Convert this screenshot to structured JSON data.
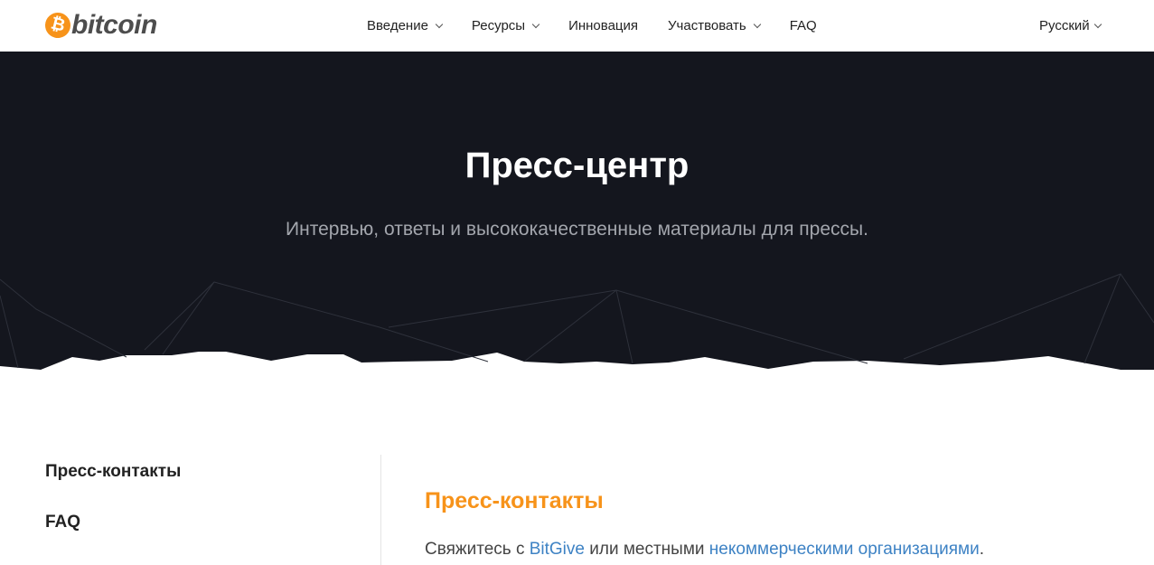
{
  "header": {
    "logo": {
      "coin_symbol": "₿",
      "text": "bitcoin",
      "color": "#f7931a"
    },
    "nav": [
      {
        "label": "Введение",
        "dropdown": true
      },
      {
        "label": "Ресурсы",
        "dropdown": true
      },
      {
        "label": "Инновация",
        "dropdown": false
      },
      {
        "label": "Участвовать",
        "dropdown": true
      },
      {
        "label": "FAQ",
        "dropdown": false
      }
    ],
    "language": "Русский"
  },
  "hero": {
    "title": "Пресс-центр",
    "subtitle": "Интервью, ответы и высококачественные материалы для прессы.",
    "background": "#14161e"
  },
  "sidebar": {
    "items": [
      {
        "label": "Пресс-контакты"
      },
      {
        "label": "FAQ"
      }
    ]
  },
  "main": {
    "section_title": "Пресс-контакты",
    "text_prefix": "Свяжитесь с ",
    "link_bitgive": "BitGive",
    "text_middle": " или местными ",
    "link_nonprofits": "некоммерческими организациями",
    "text_suffix": "."
  }
}
